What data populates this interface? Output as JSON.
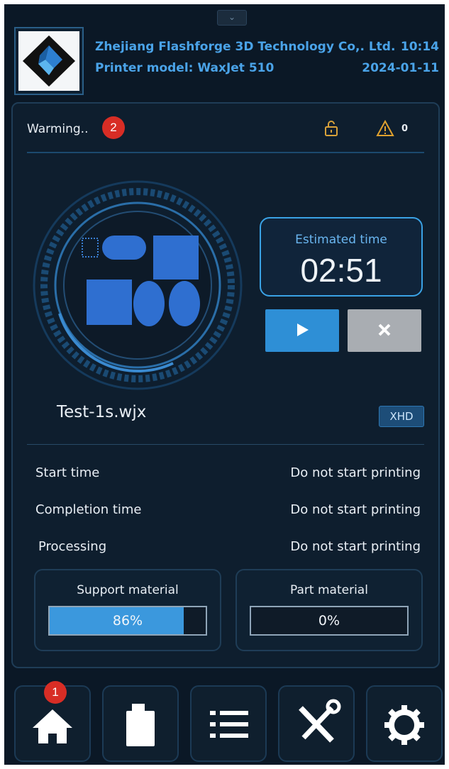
{
  "header": {
    "company": "Zhejiang Flashforge 3D Technology Co,. Ltd.",
    "model": "Printer model: WaxJet 510",
    "time": "10:14",
    "date": "2024-01-11"
  },
  "status": {
    "text": "Warming..",
    "warning_count": "0"
  },
  "print": {
    "estimated_label": "Estimated time",
    "estimated_time": "02:51",
    "filename": "Test-1s.wjx",
    "quality_badge": "XHD"
  },
  "details": [
    {
      "label": "Start time",
      "value": "Do not start printing"
    },
    {
      "label": "Completion time",
      "value": "Do not start printing"
    },
    {
      "label": "Processing",
      "value": "Do not start printing"
    }
  ],
  "materials": {
    "support": {
      "label": "Support material",
      "percent_text": "86%",
      "level": 86
    },
    "part": {
      "label": "Part material",
      "percent_text": "0%",
      "level": 0
    }
  },
  "markers": {
    "one": "1",
    "two": "2"
  },
  "icons": {
    "pull_down": "chevron-down-icon",
    "lock": "unlock-icon",
    "warning": "warning-icon",
    "play": "play-icon",
    "stop": "close-icon",
    "nav": [
      "home-icon",
      "material-canister-icon",
      "list-icon",
      "tools-icon",
      "gear-icon"
    ]
  },
  "colors": {
    "accent": "#3b98dd",
    "background": "#0b1826",
    "marker": "#d82d25",
    "warning": "#e0a12e"
  }
}
